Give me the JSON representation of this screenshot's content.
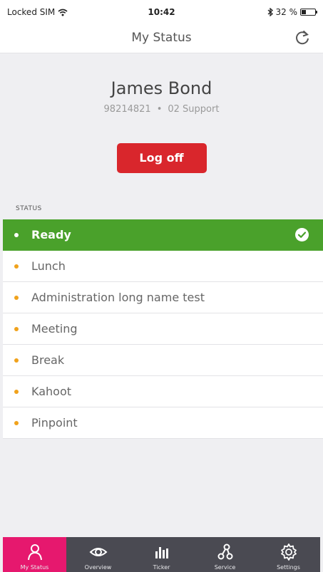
{
  "status_bar": {
    "carrier": "Locked SIM",
    "time": "10:42",
    "battery": "32 %",
    "battery_level": 0.32,
    "icons": [
      "wifi-icon",
      "bluetooth-icon",
      "battery-icon"
    ]
  },
  "navbar": {
    "title": "My Status",
    "refresh_icon": "refresh-icon"
  },
  "profile": {
    "name": "James Bond",
    "number": "98214821",
    "separator": "•",
    "team": "02 Support",
    "logoff_label": "Log off"
  },
  "status_section": {
    "label": "STATUS",
    "items": [
      {
        "label": "Ready",
        "active": true
      },
      {
        "label": "Lunch",
        "active": false
      },
      {
        "label": "Administration long name test",
        "active": false
      },
      {
        "label": "Meeting",
        "active": false
      },
      {
        "label": "Break",
        "active": false
      },
      {
        "label": "Kahoot",
        "active": false
      },
      {
        "label": "Pinpoint",
        "active": false
      }
    ]
  },
  "tabs": [
    {
      "label": "My Status",
      "icon": "person-icon",
      "active": true
    },
    {
      "label": "Overview",
      "icon": "eye-icon",
      "active": false
    },
    {
      "label": "Ticker",
      "icon": "bar-chart-icon",
      "active": false
    },
    {
      "label": "Service",
      "icon": "service-nodes-icon",
      "active": false
    },
    {
      "label": "Settings",
      "icon": "gear-icon",
      "active": false
    }
  ],
  "colors": {
    "active_status": "#4aa12b",
    "logoff_button": "#d9262c",
    "bullet": "#f0a21c",
    "tabbar": "#4a4a52",
    "active_tab": "#e6186e"
  }
}
